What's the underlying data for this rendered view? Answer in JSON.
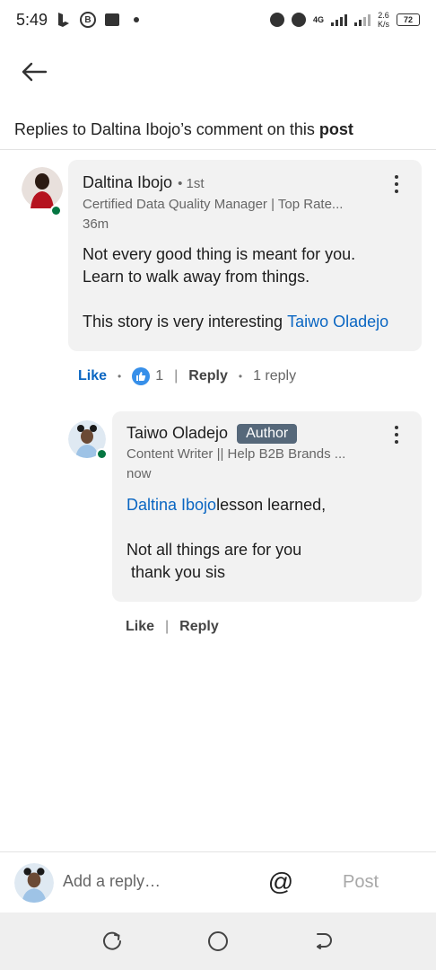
{
  "status_bar": {
    "time": "5:49",
    "network": "4G",
    "speed_value": "2.6",
    "speed_unit": "K/s",
    "battery": "72"
  },
  "header": {
    "back_icon": "arrow-left-icon",
    "context_prefix": "Replies to Daltina Ibojo’s comment on this",
    "context_suffix": "post"
  },
  "comments": [
    {
      "author": "Daltina Ibojo",
      "degree": "• 1st",
      "headline": "Certified Data Quality Manager | Top Rate...",
      "time": "36m",
      "body_line1": "Not every good thing is meant for you.",
      "body_line2": "Learn to walk away from things.",
      "body_line3_text": "This story is very interesting ",
      "body_line3_mention": "Taiwo Oladejo",
      "actions": {
        "like": "Like",
        "reaction_count": "1",
        "reply": "Reply",
        "reply_count": "1 reply"
      }
    },
    {
      "author": "Taiwo Oladejo",
      "badge": "Author",
      "headline": "Content Writer || Help B2B Brands ...",
      "time": "now",
      "body_mention": "Daltina Ibojo",
      "body_line1_text": "lesson learned,",
      "body_line2": "Not all things are for you",
      "body_line3": " thank you sis",
      "actions": {
        "like": "Like",
        "reply": "Reply"
      }
    }
  ],
  "composer": {
    "placeholder": "Add a reply…",
    "at_symbol": "@",
    "post_label": "Post"
  },
  "colors": {
    "link_blue": "#0a66c2",
    "online_green": "#057642",
    "author_badge": "#56687a",
    "bubble_bg": "#f2f2f2"
  }
}
